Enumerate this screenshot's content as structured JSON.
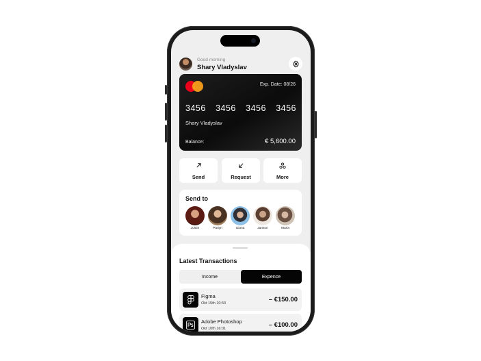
{
  "header": {
    "greeting": "Good morning",
    "user_name": "Shary Vladyslav"
  },
  "card": {
    "brand_icon": "mastercard-logo",
    "expiry": "Exp. Date: 08/26",
    "number_groups": [
      "3456",
      "3456",
      "3456",
      "3456"
    ],
    "holder": "Shary Vladyslav",
    "balance_label": "Balance:",
    "balance_value": "€ 5,600.00",
    "brand_colors": [
      "#eb001b",
      "#f79e1b"
    ]
  },
  "actions": [
    {
      "label": "Send",
      "icon": "arrow-up-right-icon"
    },
    {
      "label": "Request",
      "icon": "arrow-down-left-icon"
    },
    {
      "label": "More",
      "icon": "more-dots-icon"
    }
  ],
  "send_to": {
    "title": "Send to",
    "contacts": [
      {
        "name": "Justin",
        "color": "#7a2a1e"
      },
      {
        "name": "Pariyn",
        "color": "#8a6a48"
      },
      {
        "name": "Giana",
        "color": "#6fa3cf"
      },
      {
        "name": "Janson",
        "color": "#c9b8a8"
      },
      {
        "name": "Maria",
        "color": "#b39a86"
      }
    ]
  },
  "transactions": {
    "title": "Latest Transactions",
    "tabs": [
      {
        "label": "Income",
        "active": false
      },
      {
        "label": "Expence",
        "active": true
      }
    ],
    "items": [
      {
        "name": "Figma",
        "date": "Okt 15th 10:53",
        "amount": "– €150.00",
        "icon": "figma-icon"
      },
      {
        "name": "Adobe Photoshop",
        "date": "Okt 10th 16:01",
        "amount": "– €100.00",
        "icon": "photoshop-icon"
      }
    ]
  }
}
